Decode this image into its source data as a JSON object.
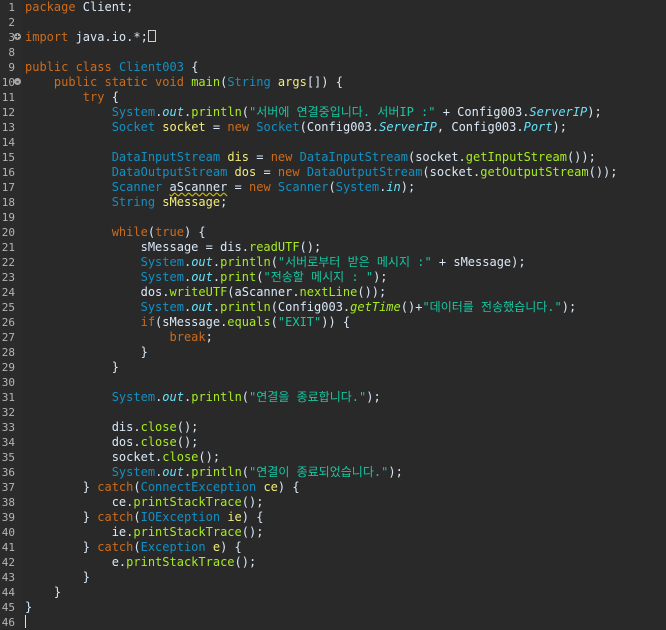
{
  "editor": {
    "lines": [
      {
        "n": "1",
        "t": [
          [
            "kw",
            "package"
          ],
          [
            "pl",
            " Client;"
          ]
        ]
      },
      {
        "n": "2",
        "t": []
      },
      {
        "n": "3",
        "fold": "+",
        "t": [
          [
            "kw",
            "import"
          ],
          [
            "pl",
            " java.io.*;"
          ],
          [
            "box",
            ""
          ]
        ]
      },
      {
        "n": "8",
        "t": []
      },
      {
        "n": "9",
        "t": [
          [
            "kw",
            "public class"
          ],
          [
            "pl",
            " "
          ],
          [
            "ty",
            "Client003"
          ],
          [
            "pl",
            " {"
          ]
        ]
      },
      {
        "n": "10",
        "fold": "-",
        "t": [
          [
            "pl",
            "    "
          ],
          [
            "kw",
            "public static void"
          ],
          [
            "pl",
            " "
          ],
          [
            "mth",
            "main"
          ],
          [
            "pl",
            "("
          ],
          [
            "ty",
            "String"
          ],
          [
            "pl",
            " "
          ],
          [
            "var",
            "args"
          ],
          [
            "pl",
            "[]) {"
          ]
        ]
      },
      {
        "n": "11",
        "t": [
          [
            "pl",
            "        "
          ],
          [
            "kw",
            "try"
          ],
          [
            "pl",
            " {"
          ]
        ]
      },
      {
        "n": "12",
        "t": [
          [
            "pl",
            "            "
          ],
          [
            "ty",
            "System"
          ],
          [
            "pl",
            "."
          ],
          [
            "fld",
            "out"
          ],
          [
            "pl",
            "."
          ],
          [
            "mth",
            "println"
          ],
          [
            "pl",
            "("
          ],
          [
            "st",
            "\"서버에 연결중입니다. 서버IP :\""
          ],
          [
            "pl",
            " + Config003."
          ],
          [
            "fld",
            "ServerIP"
          ],
          [
            "pl",
            ");"
          ]
        ]
      },
      {
        "n": "13",
        "t": [
          [
            "pl",
            "            "
          ],
          [
            "ty",
            "Socket"
          ],
          [
            "pl",
            " "
          ],
          [
            "var",
            "socket"
          ],
          [
            "pl",
            " = "
          ],
          [
            "kw",
            "new"
          ],
          [
            "pl",
            " "
          ],
          [
            "ty",
            "Socket"
          ],
          [
            "pl",
            "(Config003."
          ],
          [
            "fld",
            "ServerIP"
          ],
          [
            "pl",
            ", Config003."
          ],
          [
            "fld",
            "Port"
          ],
          [
            "pl",
            ");"
          ]
        ]
      },
      {
        "n": "14",
        "t": []
      },
      {
        "n": "15",
        "t": [
          [
            "pl",
            "            "
          ],
          [
            "ty",
            "DataInputStream"
          ],
          [
            "pl",
            " "
          ],
          [
            "var",
            "dis"
          ],
          [
            "pl",
            " = "
          ],
          [
            "kw",
            "new"
          ],
          [
            "pl",
            " "
          ],
          [
            "ty",
            "DataInputStream"
          ],
          [
            "pl",
            "(socket."
          ],
          [
            "mth",
            "getInputStream"
          ],
          [
            "pl",
            "());"
          ]
        ]
      },
      {
        "n": "16",
        "t": [
          [
            "pl",
            "            "
          ],
          [
            "ty",
            "DataOutputStream"
          ],
          [
            "pl",
            " "
          ],
          [
            "var",
            "dos"
          ],
          [
            "pl",
            " = "
          ],
          [
            "kw",
            "new"
          ],
          [
            "pl",
            " "
          ],
          [
            "ty",
            "DataOutputStream"
          ],
          [
            "pl",
            "(socket."
          ],
          [
            "mth",
            "getOutputStream"
          ],
          [
            "pl",
            "());"
          ]
        ]
      },
      {
        "n": "17",
        "t": [
          [
            "pl",
            "            "
          ],
          [
            "ty",
            "Scanner"
          ],
          [
            "pl",
            " "
          ],
          [
            "warn",
            "aScanner"
          ],
          [
            "pl",
            " = "
          ],
          [
            "kw",
            "new"
          ],
          [
            "pl",
            " "
          ],
          [
            "ty",
            "Scanner"
          ],
          [
            "pl",
            "("
          ],
          [
            "ty",
            "System"
          ],
          [
            "pl",
            "."
          ],
          [
            "fld",
            "in"
          ],
          [
            "pl",
            ");"
          ]
        ]
      },
      {
        "n": "18",
        "t": [
          [
            "pl",
            "            "
          ],
          [
            "ty",
            "String"
          ],
          [
            "pl",
            " "
          ],
          [
            "var",
            "sMessage"
          ],
          [
            "pl",
            ";"
          ]
        ]
      },
      {
        "n": "19",
        "t": []
      },
      {
        "n": "20",
        "t": [
          [
            "pl",
            "            "
          ],
          [
            "kw",
            "while"
          ],
          [
            "pl",
            "("
          ],
          [
            "kw",
            "true"
          ],
          [
            "pl",
            ") {"
          ]
        ]
      },
      {
        "n": "21",
        "t": [
          [
            "pl",
            "                sMessage = dis."
          ],
          [
            "mth",
            "readUTF"
          ],
          [
            "pl",
            "();"
          ]
        ]
      },
      {
        "n": "22",
        "t": [
          [
            "pl",
            "                "
          ],
          [
            "ty",
            "System"
          ],
          [
            "pl",
            "."
          ],
          [
            "fld",
            "out"
          ],
          [
            "pl",
            "."
          ],
          [
            "mth",
            "println"
          ],
          [
            "pl",
            "("
          ],
          [
            "st",
            "\"서버로부터 받은 메시지 :\""
          ],
          [
            "pl",
            " + sMessage);"
          ]
        ]
      },
      {
        "n": "23",
        "t": [
          [
            "pl",
            "                "
          ],
          [
            "ty",
            "System"
          ],
          [
            "pl",
            "."
          ],
          [
            "fld",
            "out"
          ],
          [
            "pl",
            "."
          ],
          [
            "mth",
            "print"
          ],
          [
            "pl",
            "("
          ],
          [
            "st",
            "\"전송할 메시지 : \""
          ],
          [
            "pl",
            ");"
          ]
        ]
      },
      {
        "n": "24",
        "t": [
          [
            "pl",
            "                dos."
          ],
          [
            "mth",
            "writeUTF"
          ],
          [
            "pl",
            "(aScanner."
          ],
          [
            "mth",
            "nextLine"
          ],
          [
            "pl",
            "());"
          ]
        ]
      },
      {
        "n": "25",
        "t": [
          [
            "pl",
            "                "
          ],
          [
            "ty",
            "System"
          ],
          [
            "pl",
            "."
          ],
          [
            "fld",
            "out"
          ],
          [
            "pl",
            "."
          ],
          [
            "mth",
            "println"
          ],
          [
            "pl",
            "(Config003."
          ],
          [
            "mthi",
            "getTime"
          ],
          [
            "pl",
            "()+"
          ],
          [
            "st",
            "\"데이터를 전송했습니다.\""
          ],
          [
            "pl",
            ");"
          ]
        ]
      },
      {
        "n": "26",
        "t": [
          [
            "pl",
            "                "
          ],
          [
            "kw",
            "if"
          ],
          [
            "pl",
            "(sMessage."
          ],
          [
            "mth",
            "equals"
          ],
          [
            "pl",
            "("
          ],
          [
            "st",
            "\"EXIT\""
          ],
          [
            "pl",
            ")) {"
          ]
        ]
      },
      {
        "n": "27",
        "t": [
          [
            "pl",
            "                    "
          ],
          [
            "kw",
            "break"
          ],
          [
            "pl",
            ";"
          ]
        ]
      },
      {
        "n": "28",
        "t": [
          [
            "pl",
            "                }"
          ]
        ]
      },
      {
        "n": "29",
        "t": [
          [
            "pl",
            "            }"
          ]
        ]
      },
      {
        "n": "30",
        "t": []
      },
      {
        "n": "31",
        "t": [
          [
            "pl",
            "            "
          ],
          [
            "ty",
            "System"
          ],
          [
            "pl",
            "."
          ],
          [
            "fld",
            "out"
          ],
          [
            "pl",
            "."
          ],
          [
            "mth",
            "println"
          ],
          [
            "pl",
            "("
          ],
          [
            "st",
            "\"연결을 종료합니다.\""
          ],
          [
            "pl",
            ");"
          ]
        ]
      },
      {
        "n": "32",
        "t": []
      },
      {
        "n": "33",
        "t": [
          [
            "pl",
            "            dis."
          ],
          [
            "mth",
            "close"
          ],
          [
            "pl",
            "();"
          ]
        ]
      },
      {
        "n": "34",
        "t": [
          [
            "pl",
            "            dos."
          ],
          [
            "mth",
            "close"
          ],
          [
            "pl",
            "();"
          ]
        ]
      },
      {
        "n": "35",
        "t": [
          [
            "pl",
            "            socket."
          ],
          [
            "mth",
            "close"
          ],
          [
            "pl",
            "();"
          ]
        ]
      },
      {
        "n": "36",
        "t": [
          [
            "pl",
            "            "
          ],
          [
            "ty",
            "System"
          ],
          [
            "pl",
            "."
          ],
          [
            "fld",
            "out"
          ],
          [
            "pl",
            "."
          ],
          [
            "mth",
            "println"
          ],
          [
            "pl",
            "("
          ],
          [
            "st",
            "\"연결이 종료되었습니다.\""
          ],
          [
            "pl",
            ");"
          ]
        ]
      },
      {
        "n": "37",
        "t": [
          [
            "pl",
            "        } "
          ],
          [
            "kw",
            "catch"
          ],
          [
            "pl",
            "("
          ],
          [
            "ty",
            "ConnectException"
          ],
          [
            "pl",
            " "
          ],
          [
            "var",
            "ce"
          ],
          [
            "pl",
            ") {"
          ]
        ]
      },
      {
        "n": "38",
        "t": [
          [
            "pl",
            "            ce."
          ],
          [
            "mth",
            "printStackTrace"
          ],
          [
            "pl",
            "();"
          ]
        ]
      },
      {
        "n": "39",
        "t": [
          [
            "pl",
            "        } "
          ],
          [
            "kw",
            "catch"
          ],
          [
            "pl",
            "("
          ],
          [
            "ty",
            "IOException"
          ],
          [
            "pl",
            " "
          ],
          [
            "var",
            "ie"
          ],
          [
            "pl",
            ") {"
          ]
        ]
      },
      {
        "n": "40",
        "t": [
          [
            "pl",
            "            ie."
          ],
          [
            "mth",
            "printStackTrace"
          ],
          [
            "pl",
            "();"
          ]
        ]
      },
      {
        "n": "41",
        "t": [
          [
            "pl",
            "        } "
          ],
          [
            "kw",
            "catch"
          ],
          [
            "pl",
            "("
          ],
          [
            "ty",
            "Exception"
          ],
          [
            "pl",
            " "
          ],
          [
            "var",
            "e"
          ],
          [
            "pl",
            ") {"
          ]
        ]
      },
      {
        "n": "42",
        "t": [
          [
            "pl",
            "            e."
          ],
          [
            "mth",
            "printStackTrace"
          ],
          [
            "pl",
            "();"
          ]
        ]
      },
      {
        "n": "43",
        "t": [
          [
            "pl",
            "        }"
          ]
        ]
      },
      {
        "n": "44",
        "t": [
          [
            "pl",
            "    }"
          ]
        ]
      },
      {
        "n": "45",
        "t": [
          [
            "pl",
            "}"
          ]
        ]
      },
      {
        "n": "46",
        "caret": true,
        "t": []
      }
    ]
  },
  "colors": {
    "background": "#292929",
    "keyword": "#cc6c1d",
    "type": "#1290c3",
    "string": "#17c6a3",
    "field": "#66e1f8",
    "method": "#a7ec21",
    "variable": "#f3ec79",
    "plain": "#d9e8f7",
    "line_number": "#b5b5b5"
  }
}
